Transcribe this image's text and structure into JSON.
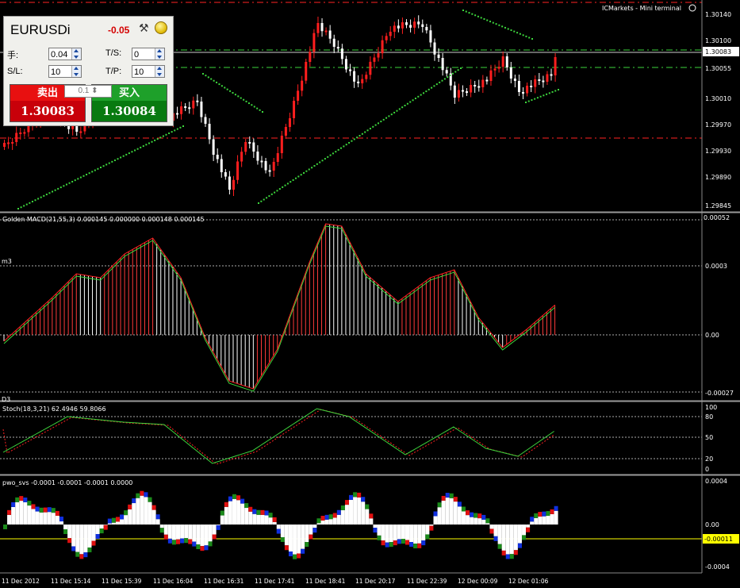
{
  "terminal": {
    "title": "ICMarkets - Mini terminal"
  },
  "trade_panel": {
    "symbol": "EURUSDi",
    "change": "-0.05",
    "lots_label": "手:",
    "lots_value": "0.04",
    "ts_label": "T/S:",
    "ts_value": "0",
    "sl_label": "S/L:",
    "sl_value": "10",
    "tp_label": "T/P:",
    "tp_value": "10",
    "step_value": "0.1",
    "sell_label": "卖出",
    "sell_price": "1.30083",
    "buy_label": "买入",
    "buy_price": "1.30084",
    "colors": {
      "sell": "#c8000a",
      "buy": "#087a10"
    }
  },
  "price_axis": {
    "labels": [
      "1.30140",
      "1.30100",
      "1.30083",
      "1.30055",
      "1.30010",
      "1.29970",
      "1.29930",
      "1.29890",
      "1.29845"
    ],
    "current": "1.30083"
  },
  "macd": {
    "header": "Golden MACD(21,55,3) 0.000145 0.000000 0.000148 0.000145",
    "axis": [
      "0.00052",
      "0.0003",
      "0.00",
      "-0.00027"
    ],
    "left_marks": [
      "m3",
      "D3"
    ]
  },
  "stoch": {
    "header": "Stoch(18,3,21) 62.4946 59.8066",
    "axis": [
      "100",
      "80",
      "50",
      "20",
      "0"
    ]
  },
  "pwo": {
    "header": "pwo_svs -0.0001 -0.0001 -0.0001 0.0000",
    "axis": [
      "0.0004",
      "0.00",
      "-0.0004"
    ],
    "current": "-0.00011"
  },
  "time_axis": [
    "11 Dec 2012",
    "11 Dec 15:14",
    "11 Dec 15:39",
    "11 Dec 16:04",
    "11 Dec 16:31",
    "11 Dec 17:41",
    "11 Dec 18:41",
    "11 Dec 20:17",
    "11 Dec 22:39",
    "12 Dec 00:09",
    "12 Dec 01:06"
  ],
  "colors": {
    "up": "#ff1e1e",
    "down": "#ffffff",
    "signal": "#3dd63d",
    "level": "#ff2222",
    "accent": "#ffff00"
  }
}
